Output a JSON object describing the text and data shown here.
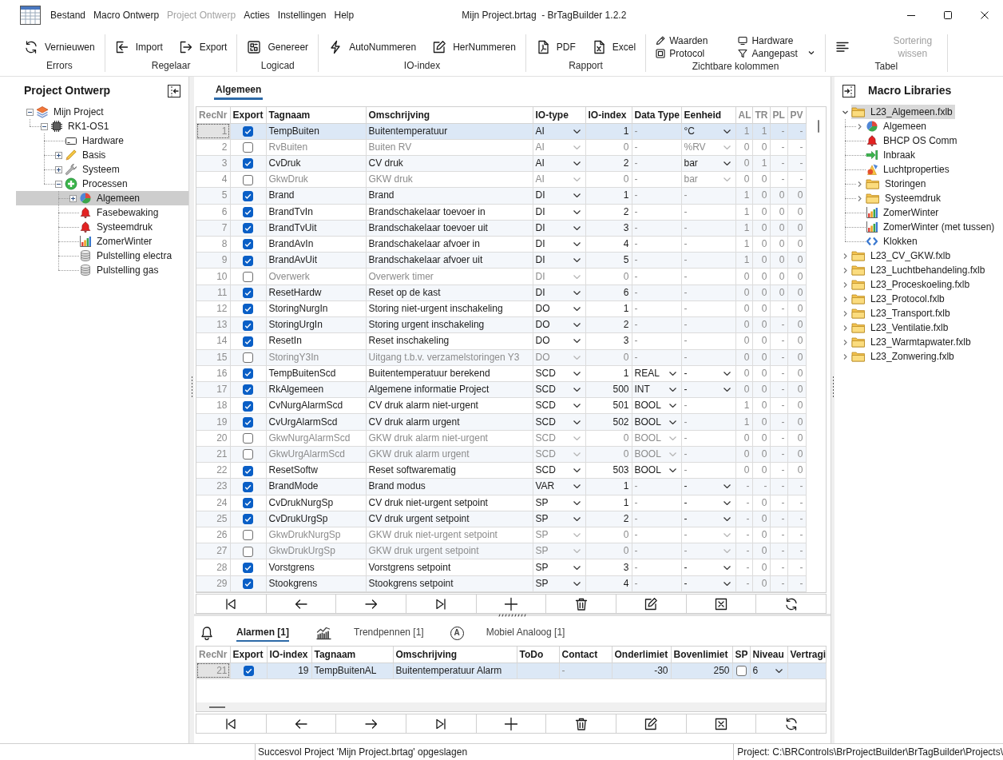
{
  "window": {
    "title": "Mijn Project.brtag  - BrTagBuilder 1.2.2"
  },
  "menu": [
    {
      "label": "Bestand",
      "disabled": false
    },
    {
      "label": "Macro Ontwerp",
      "disabled": false
    },
    {
      "label": "Project Ontwerp",
      "disabled": true
    },
    {
      "label": "Acties",
      "disabled": false
    },
    {
      "label": "Instellingen",
      "disabled": false
    },
    {
      "label": "Help",
      "disabled": false
    }
  ],
  "ribbon": {
    "groups": [
      {
        "label": "Errors",
        "kind": "large",
        "buttons": [
          {
            "kind": "refresh",
            "label": "Vernieuwen",
            "disabled": false
          }
        ]
      },
      {
        "label": "Regelaar",
        "kind": "large",
        "buttons": [
          {
            "kind": "import",
            "label": "Import",
            "disabled": false
          },
          {
            "kind": "export",
            "label": "Export",
            "disabled": false
          }
        ]
      },
      {
        "label": "Logicad",
        "kind": "large",
        "buttons": [
          {
            "kind": "generate",
            "label": "Genereer",
            "disabled": false
          }
        ]
      },
      {
        "label": "IO-index",
        "kind": "large",
        "buttons": [
          {
            "kind": "lightning",
            "label": "AutoNummeren",
            "disabled": false
          },
          {
            "kind": "edit",
            "label": "HerNummeren",
            "disabled": false
          }
        ]
      },
      {
        "label": "Rapport",
        "kind": "large",
        "buttons": [
          {
            "kind": "pdf",
            "label": "PDF",
            "disabled": false
          },
          {
            "kind": "excel",
            "label": "Excel",
            "disabled": false
          }
        ]
      },
      {
        "label": "Zichtbare kolommen",
        "kind": "small",
        "buttons": [
          {
            "kind": "pencil",
            "label": "Waarden",
            "disabled": false
          },
          {
            "kind": "frame",
            "label": "Protocol",
            "disabled": false
          },
          {
            "kind": "monitor",
            "label": "Hardware",
            "disabled": false
          },
          {
            "kind": "filter",
            "label": "Aangepast",
            "disabled": false
          },
          {
            "kind": "more",
            "disabled": false
          }
        ]
      },
      {
        "label": "Tabel",
        "kind": "large",
        "buttons": [
          {
            "kind": "lines",
            "disabled": false
          },
          {
            "kind": "text",
            "label": "Sortering wissen",
            "disabled": true
          }
        ]
      }
    ]
  },
  "project_panel": {
    "title": "Project Ontwerp",
    "tree": [
      {
        "label": "Mijn Project",
        "kind": "project",
        "expanded": true,
        "selected": false,
        "children": [
          {
            "label": "RK1-OS1",
            "kind": "controller",
            "expanded": true,
            "selected": false,
            "children": [
              {
                "label": "Hardware",
                "kind": "hardware",
                "selected": false
              },
              {
                "label": "Basis",
                "kind": "base",
                "expanded": false,
                "selected": false
              },
              {
                "label": "Systeem",
                "kind": "system",
                "expanded": false,
                "selected": false
              },
              {
                "label": "Processen",
                "kind": "group",
                "expanded": true,
                "selected": false,
                "children": [
                  {
                    "label": "Algemeen",
                    "kind": "macro",
                    "expanded": false,
                    "selected": true
                  },
                  {
                    "label": "Fasebewaking",
                    "kind": "alarm",
                    "selected": false
                  },
                  {
                    "label": "Systeemdruk",
                    "kind": "alarm",
                    "selected": false
                  },
                  {
                    "label": "ZomerWinter",
                    "kind": "trend",
                    "selected": false
                  },
                  {
                    "label": "Pulstelling electra",
                    "kind": "counter",
                    "selected": false
                  },
                  {
                    "label": "Pulstelling gas",
                    "kind": "counter",
                    "selected": false
                  }
                ]
              }
            ]
          }
        ]
      }
    ]
  },
  "editor": {
    "tabs": [
      {
        "label": "Algemeen",
        "selected": true
      }
    ],
    "table": {
      "columns": [
        {
          "label": "RecNr",
          "readonly": true
        },
        {
          "label": "Export",
          "readonly": false
        },
        {
          "label": "Tagnaam",
          "readonly": false
        },
        {
          "label": "Omschrijving",
          "readonly": false
        },
        {
          "label": "IO-type",
          "readonly": false
        },
        {
          "label": "IO-index",
          "readonly": false
        },
        {
          "label": "Data Type",
          "readonly": false
        },
        {
          "label": "Eenheid",
          "readonly": false
        },
        {
          "label": "AL",
          "readonly": true
        },
        {
          "label": "TR",
          "readonly": true
        },
        {
          "label": "PL",
          "readonly": true
        },
        {
          "label": "PV",
          "readonly": true
        }
      ],
      "rows": [
        {
          "recnr": "1",
          "export": true,
          "tagnaam": "TempBuiten",
          "omschrijving": "Buitentemperatuur",
          "io_type": "AI",
          "io_index": "1",
          "data_type": "-",
          "data_type_dropdown": false,
          "eenheid": "°C",
          "eenheid_dropdown": true,
          "al": "1",
          "tr": "1",
          "pl": "-",
          "pv": "-",
          "selected": true
        },
        {
          "recnr": "2",
          "export": false,
          "tagnaam": "RvBuiten",
          "omschrijving": "Buiten RV",
          "io_type": "AI",
          "io_index": "0",
          "data_type": "-",
          "data_type_dropdown": false,
          "eenheid": "%RV",
          "eenheid_dropdown": true,
          "al": "0",
          "tr": "0",
          "pl": "-",
          "pv": "-",
          "selected": false
        },
        {
          "recnr": "3",
          "export": true,
          "tagnaam": "CvDruk",
          "omschrijving": "CV druk",
          "io_type": "AI",
          "io_index": "2",
          "data_type": "-",
          "data_type_dropdown": false,
          "eenheid": "bar",
          "eenheid_dropdown": true,
          "al": "0",
          "tr": "1",
          "pl": "-",
          "pv": "-",
          "selected": false
        },
        {
          "recnr": "4",
          "export": false,
          "tagnaam": "GkwDruk",
          "omschrijving": "GKW druk",
          "io_type": "AI",
          "io_index": "0",
          "data_type": "-",
          "data_type_dropdown": false,
          "eenheid": "bar",
          "eenheid_dropdown": true,
          "al": "0",
          "tr": "0",
          "pl": "-",
          "pv": "-",
          "selected": false
        },
        {
          "recnr": "5",
          "export": true,
          "tagnaam": "Brand",
          "omschrijving": "Brand",
          "io_type": "DI",
          "io_index": "1",
          "data_type": "-",
          "data_type_dropdown": false,
          "eenheid": "-",
          "eenheid_dropdown": false,
          "al": "1",
          "tr": "0",
          "pl": "0",
          "pv": "0",
          "selected": false
        },
        {
          "recnr": "6",
          "export": true,
          "tagnaam": "BrandTvIn",
          "omschrijving": "Brandschakelaar toevoer in",
          "io_type": "DI",
          "io_index": "2",
          "data_type": "-",
          "data_type_dropdown": false,
          "eenheid": "-",
          "eenheid_dropdown": false,
          "al": "1",
          "tr": "0",
          "pl": "0",
          "pv": "0",
          "selected": false
        },
        {
          "recnr": "7",
          "export": true,
          "tagnaam": "BrandTvUit",
          "omschrijving": "Brandschakelaar toevoer uit",
          "io_type": "DI",
          "io_index": "3",
          "data_type": "-",
          "data_type_dropdown": false,
          "eenheid": "-",
          "eenheid_dropdown": false,
          "al": "1",
          "tr": "0",
          "pl": "0",
          "pv": "0",
          "selected": false
        },
        {
          "recnr": "8",
          "export": true,
          "tagnaam": "BrandAvIn",
          "omschrijving": "Brandschakelaar afvoer in",
          "io_type": "DI",
          "io_index": "4",
          "data_type": "-",
          "data_type_dropdown": false,
          "eenheid": "-",
          "eenheid_dropdown": false,
          "al": "1",
          "tr": "0",
          "pl": "0",
          "pv": "0",
          "selected": false
        },
        {
          "recnr": "9",
          "export": true,
          "tagnaam": "BrandAvUit",
          "omschrijving": "Brandschakelaar afvoer uit",
          "io_type": "DI",
          "io_index": "5",
          "data_type": "-",
          "data_type_dropdown": false,
          "eenheid": "-",
          "eenheid_dropdown": false,
          "al": "1",
          "tr": "0",
          "pl": "0",
          "pv": "0",
          "selected": false
        },
        {
          "recnr": "10",
          "export": false,
          "tagnaam": "Overwerk",
          "omschrijving": "Overwerk timer",
          "io_type": "DI",
          "io_index": "0",
          "data_type": "-",
          "data_type_dropdown": false,
          "eenheid": "-",
          "eenheid_dropdown": false,
          "al": "0",
          "tr": "0",
          "pl": "0",
          "pv": "0",
          "selected": false
        },
        {
          "recnr": "11",
          "export": true,
          "tagnaam": "ResetHardw",
          "omschrijving": "Reset op de kast",
          "io_type": "DI",
          "io_index": "6",
          "data_type": "-",
          "data_type_dropdown": false,
          "eenheid": "-",
          "eenheid_dropdown": false,
          "al": "0",
          "tr": "0",
          "pl": "0",
          "pv": "0",
          "selected": false
        },
        {
          "recnr": "12",
          "export": true,
          "tagnaam": "StoringNurgIn",
          "omschrijving": "Storing niet-urgent inschakeling",
          "io_type": "DO",
          "io_index": "1",
          "data_type": "-",
          "data_type_dropdown": false,
          "eenheid": "-",
          "eenheid_dropdown": false,
          "al": "0",
          "tr": "0",
          "pl": "-",
          "pv": "0",
          "selected": false
        },
        {
          "recnr": "13",
          "export": true,
          "tagnaam": "StoringUrgIn",
          "omschrijving": "Storing urgent inschakeling",
          "io_type": "DO",
          "io_index": "2",
          "data_type": "-",
          "data_type_dropdown": false,
          "eenheid": "-",
          "eenheid_dropdown": false,
          "al": "0",
          "tr": "0",
          "pl": "-",
          "pv": "0",
          "selected": false
        },
        {
          "recnr": "14",
          "export": true,
          "tagnaam": "ResetIn",
          "omschrijving": "Reset inschakeling",
          "io_type": "DO",
          "io_index": "3",
          "data_type": "-",
          "data_type_dropdown": false,
          "eenheid": "-",
          "eenheid_dropdown": false,
          "al": "0",
          "tr": "0",
          "pl": "-",
          "pv": "0",
          "selected": false
        },
        {
          "recnr": "15",
          "export": false,
          "tagnaam": "StoringY3In",
          "omschrijving": "Uitgang t.b.v. verzamelstoringen Y3",
          "io_type": "DO",
          "io_index": "0",
          "data_type": "-",
          "data_type_dropdown": false,
          "eenheid": "-",
          "eenheid_dropdown": false,
          "al": "0",
          "tr": "0",
          "pl": "-",
          "pv": "0",
          "selected": false
        },
        {
          "recnr": "16",
          "export": true,
          "tagnaam": "TempBuitenScd",
          "omschrijving": "Buitentemperatuur berekend",
          "io_type": "SCD",
          "io_index": "1",
          "data_type": "REAL",
          "data_type_dropdown": true,
          "eenheid": "-",
          "eenheid_dropdown": true,
          "al": "0",
          "tr": "0",
          "pl": "-",
          "pv": "0",
          "selected": false
        },
        {
          "recnr": "17",
          "export": true,
          "tagnaam": "RkAlgemeen",
          "omschrijving": "Algemene informatie Project",
          "io_type": "SCD",
          "io_index": "500",
          "data_type": "INT",
          "data_type_dropdown": true,
          "eenheid": "-",
          "eenheid_dropdown": true,
          "al": "0",
          "tr": "0",
          "pl": "-",
          "pv": "0",
          "selected": false
        },
        {
          "recnr": "18",
          "export": true,
          "tagnaam": "CvNurgAlarmScd",
          "omschrijving": "CV druk alarm niet-urgent",
          "io_type": "SCD",
          "io_index": "501",
          "data_type": "BOOL",
          "data_type_dropdown": true,
          "eenheid": "-",
          "eenheid_dropdown": false,
          "al": "1",
          "tr": "0",
          "pl": "-",
          "pv": "0",
          "selected": false
        },
        {
          "recnr": "19",
          "export": true,
          "tagnaam": "CvUrgAlarmScd",
          "omschrijving": "CV druk alarm urgent",
          "io_type": "SCD",
          "io_index": "502",
          "data_type": "BOOL",
          "data_type_dropdown": true,
          "eenheid": "-",
          "eenheid_dropdown": false,
          "al": "1",
          "tr": "0",
          "pl": "-",
          "pv": "0",
          "selected": false
        },
        {
          "recnr": "20",
          "export": false,
          "tagnaam": "GkwNurgAlarmScd",
          "omschrijving": "GKW druk alarm niet-urgent",
          "io_type": "SCD",
          "io_index": "0",
          "data_type": "BOOL",
          "data_type_dropdown": true,
          "eenheid": "-",
          "eenheid_dropdown": false,
          "al": "0",
          "tr": "0",
          "pl": "-",
          "pv": "0",
          "selected": false
        },
        {
          "recnr": "21",
          "export": false,
          "tagnaam": "GkwUrgAlarmScd",
          "omschrijving": "GKW druk alarm urgent",
          "io_type": "SCD",
          "io_index": "0",
          "data_type": "BOOL",
          "data_type_dropdown": true,
          "eenheid": "-",
          "eenheid_dropdown": false,
          "al": "0",
          "tr": "0",
          "pl": "-",
          "pv": "0",
          "selected": false
        },
        {
          "recnr": "22",
          "export": true,
          "tagnaam": "ResetSoftw",
          "omschrijving": "Reset softwarematig",
          "io_type": "SCD",
          "io_index": "503",
          "data_type": "BOOL",
          "data_type_dropdown": true,
          "eenheid": "-",
          "eenheid_dropdown": false,
          "al": "0",
          "tr": "0",
          "pl": "-",
          "pv": "0",
          "selected": false
        },
        {
          "recnr": "23",
          "export": true,
          "tagnaam": "BrandMode",
          "omschrijving": "Brand modus",
          "io_type": "VAR",
          "io_index": "1",
          "data_type": "-",
          "data_type_dropdown": false,
          "eenheid": "-",
          "eenheid_dropdown": true,
          "al": "-",
          "tr": "-",
          "pl": "-",
          "pv": "-",
          "selected": false
        },
        {
          "recnr": "24",
          "export": true,
          "tagnaam": "CvDrukNurgSp",
          "omschrijving": "CV druk niet-urgent setpoint",
          "io_type": "SP",
          "io_index": "1",
          "data_type": "-",
          "data_type_dropdown": false,
          "eenheid": "-",
          "eenheid_dropdown": true,
          "al": "-",
          "tr": "0",
          "pl": "-",
          "pv": "-",
          "selected": false
        },
        {
          "recnr": "25",
          "export": true,
          "tagnaam": "CvDrukUrgSp",
          "omschrijving": "CV druk urgent setpoint",
          "io_type": "SP",
          "io_index": "2",
          "data_type": "-",
          "data_type_dropdown": false,
          "eenheid": "-",
          "eenheid_dropdown": true,
          "al": "-",
          "tr": "0",
          "pl": "-",
          "pv": "-",
          "selected": false
        },
        {
          "recnr": "26",
          "export": false,
          "tagnaam": "GkwDrukNurgSp",
          "omschrijving": "GKW druk niet-urgent setpoint",
          "io_type": "SP",
          "io_index": "0",
          "data_type": "-",
          "data_type_dropdown": false,
          "eenheid": "-",
          "eenheid_dropdown": true,
          "al": "-",
          "tr": "0",
          "pl": "-",
          "pv": "-",
          "selected": false
        },
        {
          "recnr": "27",
          "export": false,
          "tagnaam": "GkwDrukUrgSp",
          "omschrijving": "GKW druk urgent setpoint",
          "io_type": "SP",
          "io_index": "0",
          "data_type": "-",
          "data_type_dropdown": false,
          "eenheid": "-",
          "eenheid_dropdown": true,
          "al": "-",
          "tr": "0",
          "pl": "-",
          "pv": "-",
          "selected": false
        },
        {
          "recnr": "28",
          "export": true,
          "tagnaam": "Vorstgrens",
          "omschrijving": "Vorstgrens setpoint",
          "io_type": "SP",
          "io_index": "3",
          "data_type": "-",
          "data_type_dropdown": false,
          "eenheid": "-",
          "eenheid_dropdown": true,
          "al": "-",
          "tr": "0",
          "pl": "-",
          "pv": "-",
          "selected": false
        },
        {
          "recnr": "29",
          "export": true,
          "tagnaam": "Stookgrens",
          "omschrijving": "Stookgrens setpoint",
          "io_type": "SP",
          "io_index": "4",
          "data_type": "-",
          "data_type_dropdown": false,
          "eenheid": "-",
          "eenheid_dropdown": true,
          "al": "-",
          "tr": "0",
          "pl": "-",
          "pv": "-",
          "selected": false
        }
      ]
    }
  },
  "details": {
    "tabs": [
      {
        "label": "Alarmen [1]",
        "kind": "alarm",
        "selected": true
      },
      {
        "label": "Trendpennen [1]",
        "kind": "trend",
        "selected": false
      },
      {
        "label": "Mobiel Analoog [1]",
        "kind": "letter",
        "letter": "A",
        "selected": false
      }
    ],
    "table": {
      "columns": [
        {
          "label": "RecNr",
          "readonly": true
        },
        {
          "label": "Export",
          "readonly": false
        },
        {
          "label": "IO-index",
          "readonly": false
        },
        {
          "label": "Tagnaam",
          "readonly": false
        },
        {
          "label": "Omschrijving",
          "readonly": false
        },
        {
          "label": "ToDo",
          "readonly": false
        },
        {
          "label": "Contact",
          "readonly": false
        },
        {
          "label": "Onderlimiet",
          "readonly": false
        },
        {
          "label": "Bovenlimiet",
          "readonly": false
        },
        {
          "label": "SP",
          "readonly": false
        },
        {
          "label": "Niveau",
          "readonly": false
        },
        {
          "label": "Vertragi",
          "readonly": false
        }
      ],
      "rows": [
        {
          "recnr": "21",
          "export": true,
          "io_index": "19",
          "tagnaam": "TempBuitenAL",
          "omschrijving": "Buitentemperatuur Alarm",
          "contact": "-",
          "onderlimiet": "-30",
          "bovenlimiet": "250",
          "sp": false,
          "niveau": "6",
          "selected": true
        }
      ]
    }
  },
  "library_panel": {
    "title": "Macro Libraries",
    "tree": [
      {
        "label": "L23_Algemeen.fxlb",
        "kind": "library",
        "expanded": true,
        "selected": true,
        "children": [
          {
            "label": "Algemeen",
            "kind": "macro",
            "expanded": false,
            "selected": false
          },
          {
            "label": "BHCP OS Comm",
            "kind": "alarm",
            "selected": false
          },
          {
            "label": "Inbraak",
            "kind": "input",
            "selected": false
          },
          {
            "label": "Luchtproperties",
            "kind": "properties",
            "selected": false
          },
          {
            "label": "Storingen",
            "kind": "library",
            "expanded": false,
            "selected": false
          },
          {
            "label": "Systeemdruk",
            "kind": "library",
            "expanded": false,
            "selected": false
          },
          {
            "label": "ZomerWinter",
            "kind": "trend",
            "selected": false
          },
          {
            "label": "ZomerWinter (met tussen)",
            "kind": "trend",
            "selected": false
          },
          {
            "label": "Klokken",
            "kind": "clock",
            "selected": false
          }
        ]
      },
      {
        "label": "L23_CV_GKW.fxlb",
        "kind": "library",
        "expanded": false,
        "selected": false
      },
      {
        "label": "L23_Luchtbehandeling.fxlb",
        "kind": "library",
        "expanded": false,
        "selected": false
      },
      {
        "label": "L23_Proceskoeling.fxlb",
        "kind": "library",
        "expanded": false,
        "selected": false
      },
      {
        "label": "L23_Protocol.fxlb",
        "kind": "library",
        "expanded": false,
        "selected": false
      },
      {
        "label": "L23_Transport.fxlb",
        "kind": "library",
        "expanded": false,
        "selected": false
      },
      {
        "label": "L23_Ventilatie.fxlb",
        "kind": "library",
        "expanded": false,
        "selected": false
      },
      {
        "label": "L23_Warmtapwater.fxlb",
        "kind": "library",
        "expanded": false,
        "selected": false
      },
      {
        "label": "L23_Zonwering.fxlb",
        "kind": "library",
        "expanded": false,
        "selected": false
      }
    ]
  },
  "status_bar": {
    "message": "Succesvol Project 'Mijn Project.brtag' opgeslagen",
    "path": "Project: C:\\BRControls\\BrProjectBuilder\\BrTagBuilder\\Projects\\"
  }
}
